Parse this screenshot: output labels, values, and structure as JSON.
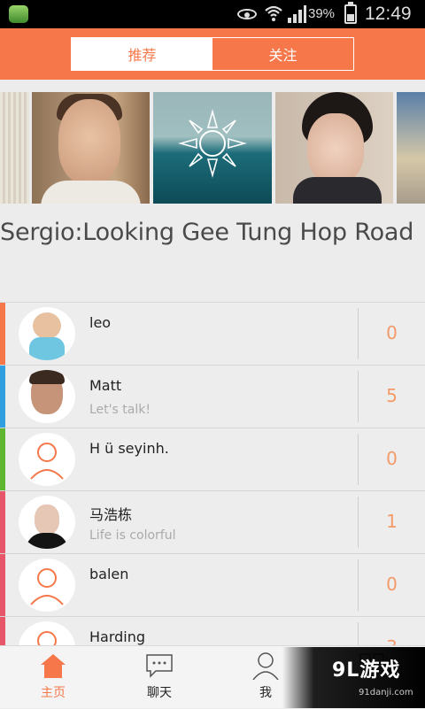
{
  "status_bar": {
    "battery": "39%",
    "time": "12:49"
  },
  "header": {
    "tabs": [
      "推荐",
      "关注"
    ],
    "active_tab": "推荐"
  },
  "featured": {
    "headline": "Sergio:Looking Gee Tung Hop Road"
  },
  "users": [
    {
      "name": "leo",
      "status": "",
      "count": "0",
      "accent": "#f6784a"
    },
    {
      "name": "Matt",
      "status": "Let's talk!",
      "count": "5",
      "accent": "#2f9fe0"
    },
    {
      "name": "H ü seyinh.",
      "status": "",
      "count": "0",
      "accent": "#5fb631"
    },
    {
      "name": "马浩栋",
      "status": "Life is colorful",
      "count": "1",
      "accent": "#e8566a"
    },
    {
      "name": "balen",
      "status": "",
      "count": "0",
      "accent": "#e8566a"
    },
    {
      "name": "Harding",
      "status": "",
      "count": "3",
      "accent": "#e8566a"
    }
  ],
  "tab_bar": {
    "home": "主页",
    "chat": "聊天",
    "me": "我"
  },
  "watermark": {
    "main": "9L游戏",
    "sub": "91danji.com"
  },
  "colors": {
    "accent": "#f6784a",
    "count": "#f39a6a"
  }
}
